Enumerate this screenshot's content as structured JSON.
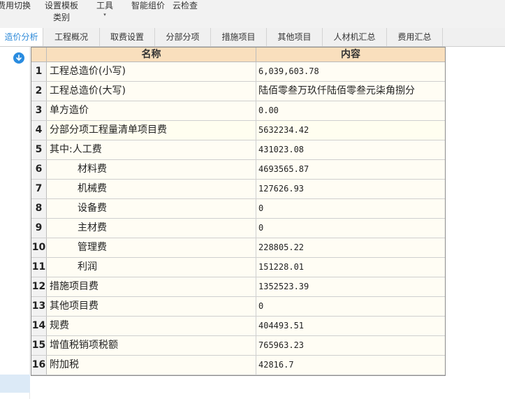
{
  "toolbar": {
    "items": [
      {
        "label": "费用切换",
        "line2": ""
      },
      {
        "label": "设置模板",
        "line2": "类别"
      },
      {
        "label": "工具",
        "line2": "▾"
      },
      {
        "label": "智能组价",
        "line2": ""
      },
      {
        "label": "云检查",
        "line2": ""
      }
    ]
  },
  "tabs": [
    {
      "label": "造价分析",
      "active": true
    },
    {
      "label": "工程概况",
      "active": false
    },
    {
      "label": "取费设置",
      "active": false
    },
    {
      "label": "分部分项",
      "active": false
    },
    {
      "label": "措施项目",
      "active": false
    },
    {
      "label": "其他项目",
      "active": false
    },
    {
      "label": "人材机汇总",
      "active": false
    },
    {
      "label": "费用汇总",
      "active": false
    }
  ],
  "sidebar": {
    "download_icon": "download-circle-icon"
  },
  "table": {
    "headers": {
      "name": "名称",
      "content": "内容"
    },
    "rows": [
      {
        "idx": "1",
        "name": "工程总造价(小写)",
        "content": "6,039,603.78"
      },
      {
        "idx": "2",
        "name": "工程总造价(大写)",
        "content": "陆佰零叁万玖仟陆佰零叁元柒角捌分"
      },
      {
        "idx": "3",
        "name": "单方造价",
        "content": "0.00"
      },
      {
        "idx": "4",
        "name": "分部分项工程量清单项目费",
        "content": "5632234.42"
      },
      {
        "idx": "5",
        "name": "其中:人工费",
        "content": "431023.08"
      },
      {
        "idx": "6",
        "name": "材料费",
        "content": "4693565.87"
      },
      {
        "idx": "7",
        "name": "机械费",
        "content": "127626.93"
      },
      {
        "idx": "8",
        "name": "设备费",
        "content": "0"
      },
      {
        "idx": "9",
        "name": "主材费",
        "content": "0"
      },
      {
        "idx": "10",
        "name": "管理费",
        "content": "228805.22"
      },
      {
        "idx": "11",
        "name": "利润",
        "content": "151228.01"
      },
      {
        "idx": "12",
        "name": "措施项目费",
        "content": "1352523.39"
      },
      {
        "idx": "13",
        "name": "其他项目费",
        "content": "0"
      },
      {
        "idx": "14",
        "name": "规费",
        "content": "404493.51"
      },
      {
        "idx": "15",
        "name": "增值税销项税额",
        "content": "765963.23"
      },
      {
        "idx": "16",
        "name": "附加税",
        "content": "42816.7"
      }
    ]
  },
  "colors": {
    "accent": "#2b88d8",
    "header_bg": "#f9dfbd",
    "grid_bg": "#fffdf4"
  }
}
